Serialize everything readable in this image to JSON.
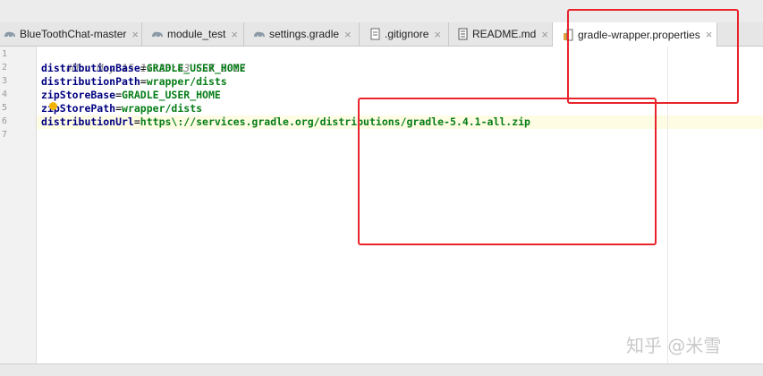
{
  "tabs": [
    {
      "label": "BlueToothChat-master",
      "icon": "gradle-elephant-icon",
      "active": false
    },
    {
      "label": "module_test",
      "icon": "gradle-elephant-icon",
      "active": false
    },
    {
      "label": "settings.gradle",
      "icon": "gradle-elephant-icon",
      "active": false
    },
    {
      "label": ".gitignore",
      "icon": "text-file-icon",
      "active": false
    },
    {
      "label": "README.md",
      "icon": "markdown-file-icon",
      "active": false
    },
    {
      "label": "gradle-wrapper.properties",
      "icon": "properties-file-icon",
      "active": true
    }
  ],
  "close_glyph": "×",
  "editor": {
    "line_numbers": [
      "1",
      "2",
      "3",
      "4",
      "5",
      "6",
      "7"
    ],
    "lines": [
      {
        "comment": "#Mon May 15 11:23:43 CST 2017"
      },
      {
        "key": "distributionBase",
        "eq": "=",
        "value": "GRADLE_USER_HOME"
      },
      {
        "key": "distributionPath",
        "eq": "=",
        "value": "wrapper/dists"
      },
      {
        "key": "zipStoreBase",
        "eq": "=",
        "value": "GRADLE_USER_HOME"
      },
      {
        "key": "zipStorePath",
        "eq": "=",
        "value": "wrapper/dists"
      },
      {
        "key": "distributionUrl",
        "eq": "=",
        "value": "https\\://services.gradle.org/distributions/gradle-5.4.1-all.zip"
      }
    ]
  },
  "watermark": "知乎 @米雪",
  "colors": {
    "annotation_red": "#e8232b",
    "current_line": "#fffce4",
    "key": "#000080",
    "value": "#067d17"
  }
}
